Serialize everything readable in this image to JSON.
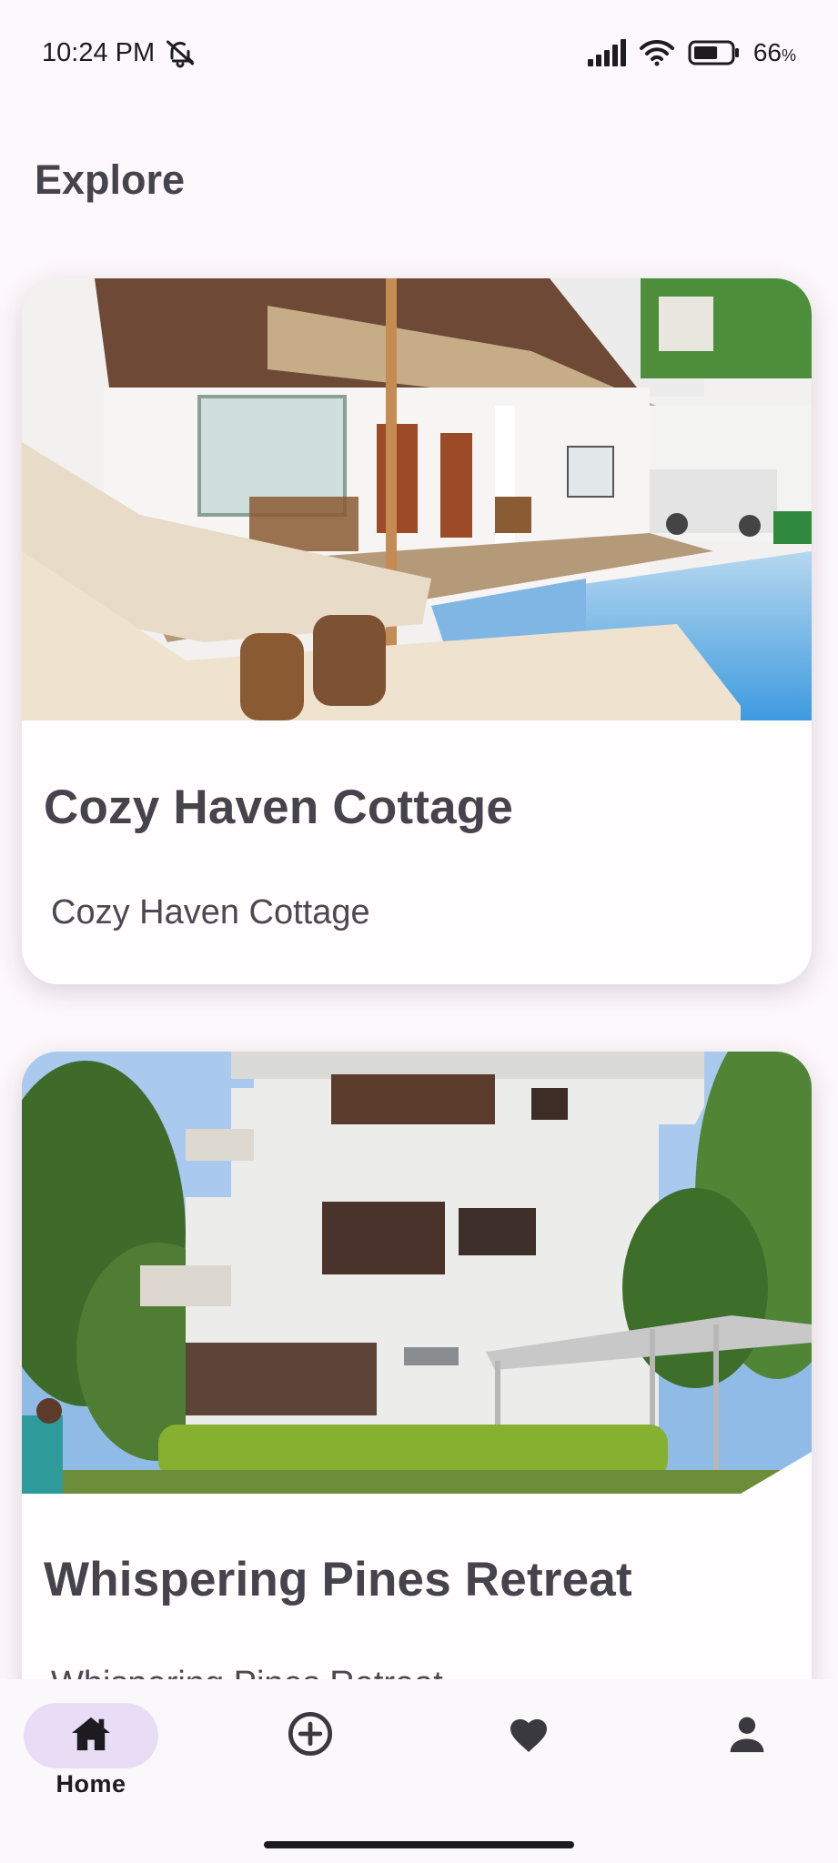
{
  "status_bar": {
    "time": "10:24 PM",
    "battery_percent": "66",
    "battery_unit": "%",
    "battery_level": 0.66,
    "icons": [
      "bell-off-icon",
      "signal-icon",
      "wifi-icon",
      "battery-icon"
    ]
  },
  "page": {
    "title": "Explore"
  },
  "listings": [
    {
      "title": "Cozy Haven Cottage",
      "subtitle": "Cozy Haven Cottage",
      "image": "villa-pool-photo"
    },
    {
      "title": "Whispering Pines Retreat",
      "subtitle": "Whispering Pines Retreat",
      "image": "white-house-garden-photo"
    }
  ],
  "nav": {
    "items": [
      {
        "label": "Home",
        "icon": "home-icon",
        "active": true
      },
      {
        "label": "",
        "icon": "add-circle-icon",
        "active": false
      },
      {
        "label": "",
        "icon": "heart-icon",
        "active": false
      },
      {
        "label": "",
        "icon": "person-icon",
        "active": false
      }
    ]
  },
  "colors": {
    "background": "#fdf8fb",
    "nav_active_pill": "#e9ddf6",
    "title_text": "#45434b"
  }
}
